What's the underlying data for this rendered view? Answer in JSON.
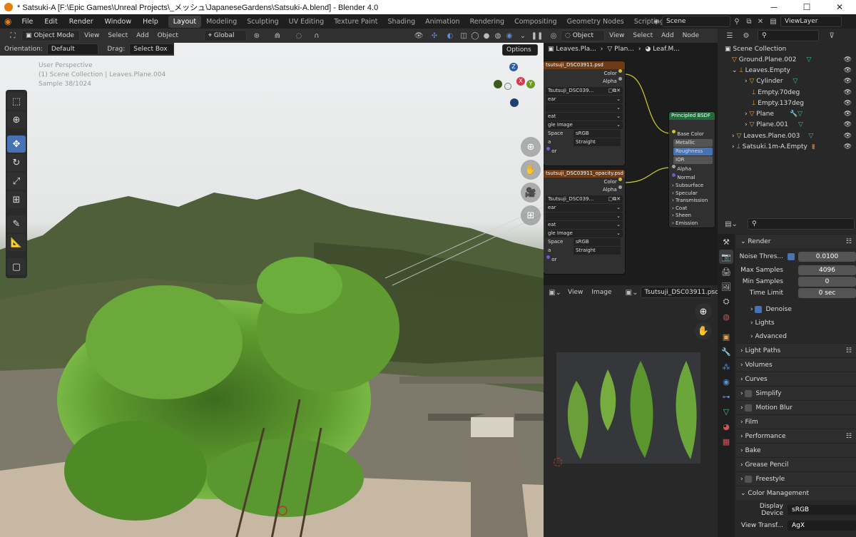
{
  "titlebar": {
    "title": "* Satsuki-A [F:\\Epic Games\\Unreal Projects\\_メッシュ\\JapaneseGardens\\Satsuki-A.blend] - Blender 4.0",
    "min": "─",
    "max": "☐",
    "close": "✕"
  },
  "menu": {
    "items": [
      "File",
      "Edit",
      "Render",
      "Window",
      "Help"
    ]
  },
  "workspaces": [
    "Layout",
    "Modeling",
    "Sculpting",
    "UV Editing",
    "Texture Paint",
    "Shading",
    "Animation",
    "Rendering",
    "Compositing",
    "Geometry Nodes",
    "Scripting"
  ],
  "scene": {
    "name": "Scene",
    "view_layer": "ViewLayer"
  },
  "viewport": {
    "mode": "Object Mode",
    "menus": [
      "View",
      "Select",
      "Add",
      "Object"
    ],
    "transform": "Global",
    "orientation_label": "Orientation:",
    "orientation_value": "Default",
    "drag_label": "Drag:",
    "drag_value": "Select Box",
    "options": "Options",
    "overlay_lines": [
      "User Perspective",
      "(1) Scene Collection | Leaves.Plane.004",
      "Sample 38/1024"
    ],
    "gizmo": {
      "x": "X",
      "y": "Y",
      "z": "Z"
    }
  },
  "node_editor": {
    "type": "Object",
    "menus": [
      "View",
      "Select",
      "Add",
      "Node"
    ],
    "breadcrumb": [
      "Leaves.Pla...",
      "Plan...",
      "Leaf.M..."
    ],
    "tex1": {
      "title": "tsutsuji_DSC03911.psd",
      "out_color": "Color",
      "out_alpha": "Alpha",
      "image": "Tsutsuji_DSC039...",
      "rows": [
        "ear",
        "",
        "eat",
        "gle Image"
      ],
      "cs_label": "Space",
      "cs_value": "sRGB",
      "alpha_value": "Straight",
      "last": "or"
    },
    "tex2": {
      "title": "tsutsuji_DSC03911_opacity.psd",
      "out_color": "Color",
      "out_alpha": "Alpha",
      "image": "Tsutsuji_DSC039...",
      "rows": [
        "ear",
        "",
        "eat",
        "gle Image"
      ],
      "cs_label": "Space",
      "cs_value": "sRGB",
      "alpha_value": "Straight",
      "last": "or"
    },
    "bsdf": {
      "title": "Principled BSDF",
      "inputs": [
        "Base Color",
        "Metallic",
        "Roughness",
        "IOR",
        "Alpha",
        "Normal"
      ],
      "panels": [
        "Subsurface",
        "Specular",
        "Transmission",
        "Coat",
        "Sheen",
        "Emission"
      ]
    }
  },
  "image_editor": {
    "menus": [
      "View",
      "Image"
    ],
    "image_name": "Tsutsuji_DSC03911.psd"
  },
  "outliner": {
    "root": "Scene Collection",
    "items": [
      "Ground.Plane.002",
      "Leaves.Empty",
      "Cylinder",
      "Empty.70deg",
      "Empty.137deg",
      "Plane",
      "Plane.001",
      "Leaves.Plane.003",
      "Satsuki.1m-A.Empty"
    ]
  },
  "properties": {
    "render_title": "Render",
    "noise_threshold": {
      "label": "Noise Thres...",
      "value": "0.0100"
    },
    "max_samples": {
      "label": "Max Samples",
      "value": "4096"
    },
    "min_samples": {
      "label": "Min Samples",
      "value": "0"
    },
    "time_limit": {
      "label": "Time Limit",
      "value": "0 sec"
    },
    "subs": [
      "Denoise",
      "Lights",
      "Advanced"
    ],
    "sections": [
      "Light Paths",
      "Volumes",
      "Curves",
      "Simplify",
      "Motion Blur",
      "Film",
      "Performance",
      "Bake",
      "Grease Pencil",
      "Freestyle",
      "Color Management"
    ],
    "display_device": {
      "label": "Display Device",
      "value": "sRGB"
    },
    "view_transform": {
      "label": "View Transf...",
      "value": "AgX"
    }
  }
}
